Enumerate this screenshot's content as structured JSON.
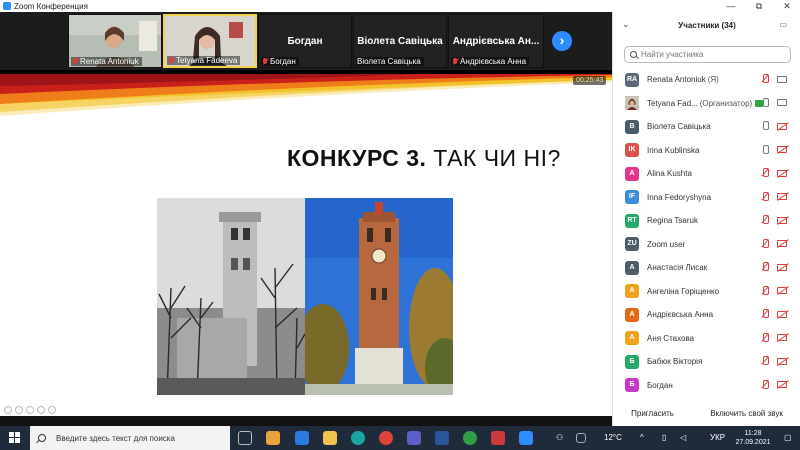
{
  "window": {
    "title": "Zoom Конференция",
    "controls": {
      "minimize": "—",
      "restore": "⧉",
      "close": "✕"
    }
  },
  "gallery": {
    "tiles": [
      {
        "name": "Renata Antoniuk",
        "type": "video",
        "muted": true
      },
      {
        "name": "Tetyana Fadeeva",
        "type": "video",
        "muted": true,
        "selected": true
      },
      {
        "name": "Богдан",
        "type": "name",
        "caption": "Богдан",
        "muted": true
      },
      {
        "name": "Віолета Савіцька",
        "type": "name",
        "caption": "Віолета Савіцька",
        "muted": false
      },
      {
        "name": "Андрієвська  Ан...",
        "type": "name",
        "caption": "Андрієвська Анна",
        "muted": true
      }
    ],
    "next_icon": "›"
  },
  "slide": {
    "timer": "00:25:43",
    "title_bold": "КОНКУРС 3.",
    "title_rest": " ТАК ЧИ НІ?"
  },
  "participants": {
    "header": "Участники (34)",
    "search_placeholder": "Найти участника",
    "list": [
      {
        "initials": "RA",
        "color": "#5b6877",
        "name": "Renata Antoniuk",
        "role": "(Я)",
        "mic": "off",
        "cam": "on"
      },
      {
        "initials": "",
        "color": "#a0522d",
        "photo": true,
        "name": "Tetyana Fad...",
        "role": "(Организатор)",
        "badge": true,
        "mic": "on",
        "cam": "on"
      },
      {
        "initials": "В",
        "color": "#4a5b69",
        "name": "Віолета Савіцька",
        "role": "",
        "mic": "on",
        "cam": "off"
      },
      {
        "initials": "IK",
        "color": "#d9534f",
        "name": "Irina Kublinska",
        "role": "",
        "mic": "on",
        "cam": "off"
      },
      {
        "initials": "A",
        "color": "#e0368c",
        "name": "Alina Kushta",
        "role": "",
        "mic": "off",
        "cam": "off"
      },
      {
        "initials": "IF",
        "color": "#3a8ed6",
        "name": "Inna Fedoryshyna",
        "role": "",
        "mic": "off",
        "cam": "off"
      },
      {
        "initials": "RT",
        "color": "#27a86b",
        "name": "Regina Tsaruk",
        "role": "",
        "mic": "off",
        "cam": "off"
      },
      {
        "initials": "ZU",
        "color": "#4a5b69",
        "name": "Zoom user",
        "role": "",
        "mic": "off",
        "cam": "off"
      },
      {
        "initials": "А",
        "color": "#4a5b69",
        "name": "Анастасія Лисак",
        "role": "",
        "mic": "off",
        "cam": "off"
      },
      {
        "initials": "А",
        "color": "#f3a21b",
        "name": "Ангеліна Горіщенко",
        "role": "",
        "mic": "off",
        "cam": "off"
      },
      {
        "initials": "А",
        "color": "#e46a1a",
        "name": "Андрієвська Анна",
        "role": "",
        "mic": "off",
        "cam": "off"
      },
      {
        "initials": "А",
        "color": "#f3a21b",
        "name": "Аня Стахова",
        "role": "",
        "mic": "off",
        "cam": "off"
      },
      {
        "initials": "Б",
        "color": "#27a86b",
        "name": "Бабюк Вікторія",
        "role": "",
        "mic": "off",
        "cam": "off"
      },
      {
        "initials": "Б",
        "color": "#c63ac7",
        "name": "Богдан",
        "role": "",
        "mic": "off",
        "cam": "off"
      }
    ],
    "invite_label": "Пригласить",
    "unmute_label": "Включить свой звук"
  },
  "taskbar": {
    "search_placeholder": "Введите здесь текст для поиска",
    "weather": "12°C",
    "lang": "УКР",
    "time": "11:28",
    "date": "27.09.2021"
  }
}
